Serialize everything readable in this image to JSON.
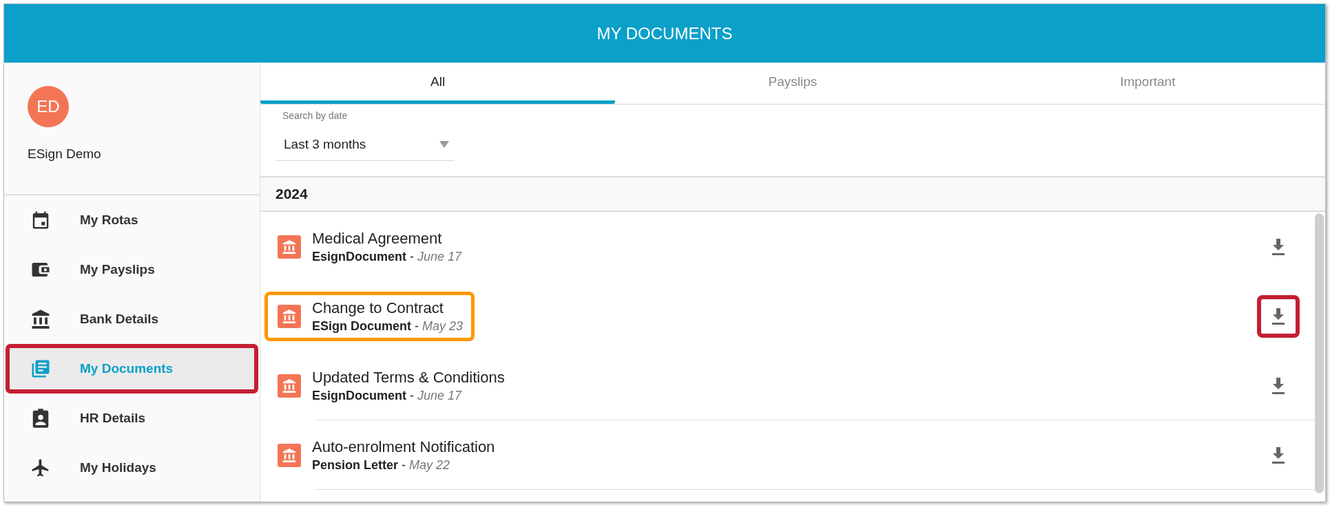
{
  "header": {
    "title": "MY DOCUMENTS"
  },
  "user": {
    "initials": "ED",
    "name": "ESign Demo"
  },
  "sidebar": {
    "items": [
      {
        "label": "My Rotas",
        "selected": false,
        "outlined": false
      },
      {
        "label": "My Payslips",
        "selected": false,
        "outlined": false
      },
      {
        "label": "Bank Details",
        "selected": false,
        "outlined": false
      },
      {
        "label": "My Documents",
        "selected": true,
        "outlined": true
      },
      {
        "label": "HR Details",
        "selected": false,
        "outlined": false
      },
      {
        "label": "My Holidays",
        "selected": false,
        "outlined": false
      }
    ]
  },
  "tabs": [
    {
      "label": "All",
      "selected": true
    },
    {
      "label": "Payslips",
      "selected": false
    },
    {
      "label": "Important",
      "selected": false
    }
  ],
  "filter": {
    "label": "Search by date",
    "value": "Last 3 months"
  },
  "year": "2024",
  "documents": [
    {
      "title": "Medical Agreement",
      "meta": "**EsignDocument** - *June 17*",
      "outlined": false,
      "download_outlined": false
    },
    {
      "title": "Change to Contract",
      "meta": "**ESign Document** - *May 23*",
      "outlined": true,
      "download_outlined": true
    },
    {
      "title": "Updated Terms & Conditions",
      "meta": "**EsignDocument** - *June 17*",
      "outlined": false,
      "download_outlined": false
    },
    {
      "title": "Auto-enrolment Notification",
      "meta": "**Pension Letter** - *May 22*",
      "outlined": false,
      "download_outlined": false
    }
  ]
}
